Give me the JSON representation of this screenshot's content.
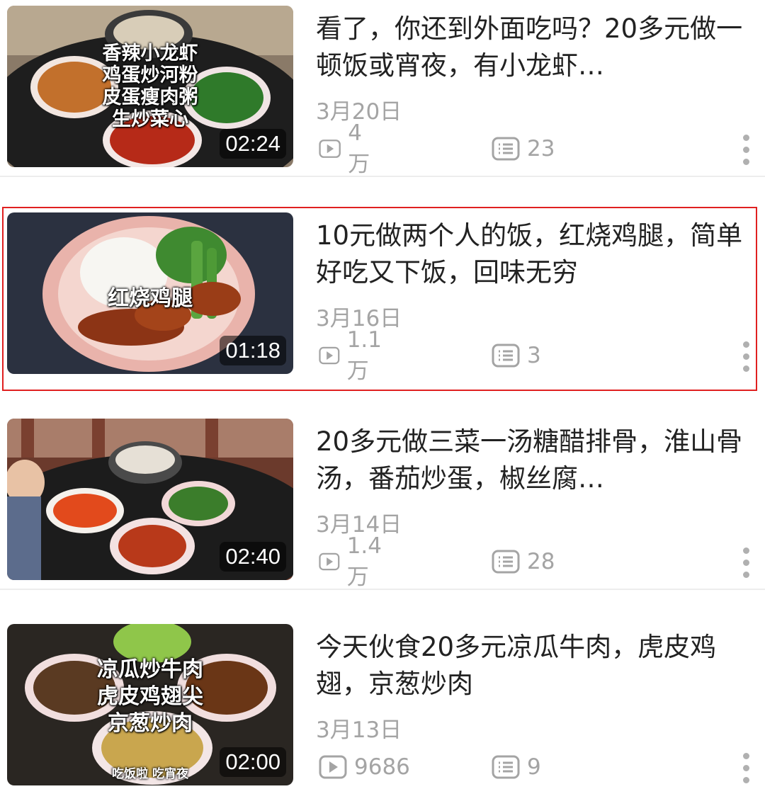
{
  "videos": [
    {
      "title": "看了，你还到外面吃吗？20多元做一顿饭或宵夜，有小龙虾…",
      "date": "3月20日",
      "plays": "4万",
      "comments": "23",
      "duration": "02:24",
      "overlay": [
        "香辣小龙虾",
        "鸡蛋炒河粉",
        "皮蛋瘦肉粥",
        "生炒菜心"
      ],
      "overlay_small": ""
    },
    {
      "title": "10元做两个人的饭，红烧鸡腿，简单好吃又下饭，回味无穷",
      "date": "3月16日",
      "plays": "1.1万",
      "comments": "3",
      "duration": "01:18",
      "overlay": [
        "红烧鸡腿"
      ],
      "overlay_small": ""
    },
    {
      "title": "20多元做三菜一汤糖醋排骨，淮山骨汤，番茄炒蛋，椒丝腐…",
      "date": "3月14日",
      "plays": "1.4万",
      "comments": "28",
      "duration": "02:40",
      "overlay": [],
      "overlay_small": ""
    },
    {
      "title": "今天伙食20多元凉瓜牛肉，虎皮鸡翅，京葱炒肉",
      "date": "3月13日",
      "plays": "9686",
      "comments": "9",
      "duration": "02:00",
      "overlay": [
        "凉瓜炒牛肉",
        "虎皮鸡翅尖",
        "京葱炒肉"
      ],
      "overlay_small": "吃饭啦 吃宵夜"
    }
  ],
  "icons": {
    "plays": "play-count-icon",
    "comments": "comment-count-icon",
    "more": "more-vertical-icon"
  },
  "colors": {
    "meta_text": "#a4a4a4",
    "highlight_border": "#e02020"
  }
}
